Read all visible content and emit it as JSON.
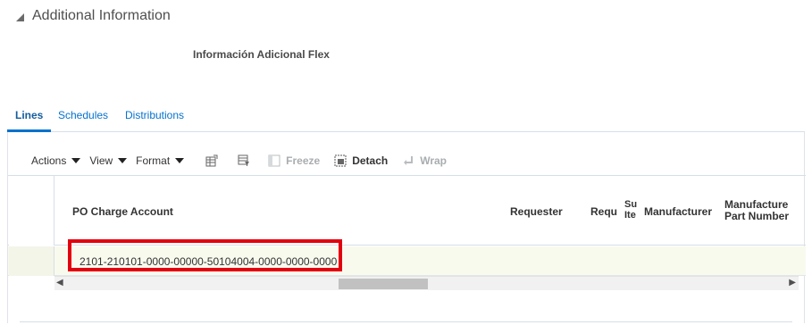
{
  "section": {
    "title": "Additional Information",
    "flex_label": "Información Adicional Flex"
  },
  "tabs": [
    {
      "label": "Lines"
    },
    {
      "label": "Schedules"
    },
    {
      "label": "Distributions"
    }
  ],
  "toolbar": {
    "actions_label": "Actions",
    "view_label": "View",
    "format_label": "Format",
    "freeze_label": "Freeze",
    "detach_label": "Detach",
    "wrap_label": "Wrap"
  },
  "table": {
    "columns": [
      {
        "label": "PO Charge Account"
      },
      {
        "label": "Requester"
      },
      {
        "label": "Requ"
      },
      {
        "label": "Su Ite"
      },
      {
        "label": "Manufacturer"
      },
      {
        "label": "Manufacture Part Number"
      }
    ],
    "rows": [
      {
        "po_charge_account": "2101-210101-0000-00000-50104004-0000-0000-0000"
      }
    ]
  },
  "colors": {
    "link": "#0572ce",
    "highlight": "#e3000f",
    "row_bg": "#f9faee"
  }
}
